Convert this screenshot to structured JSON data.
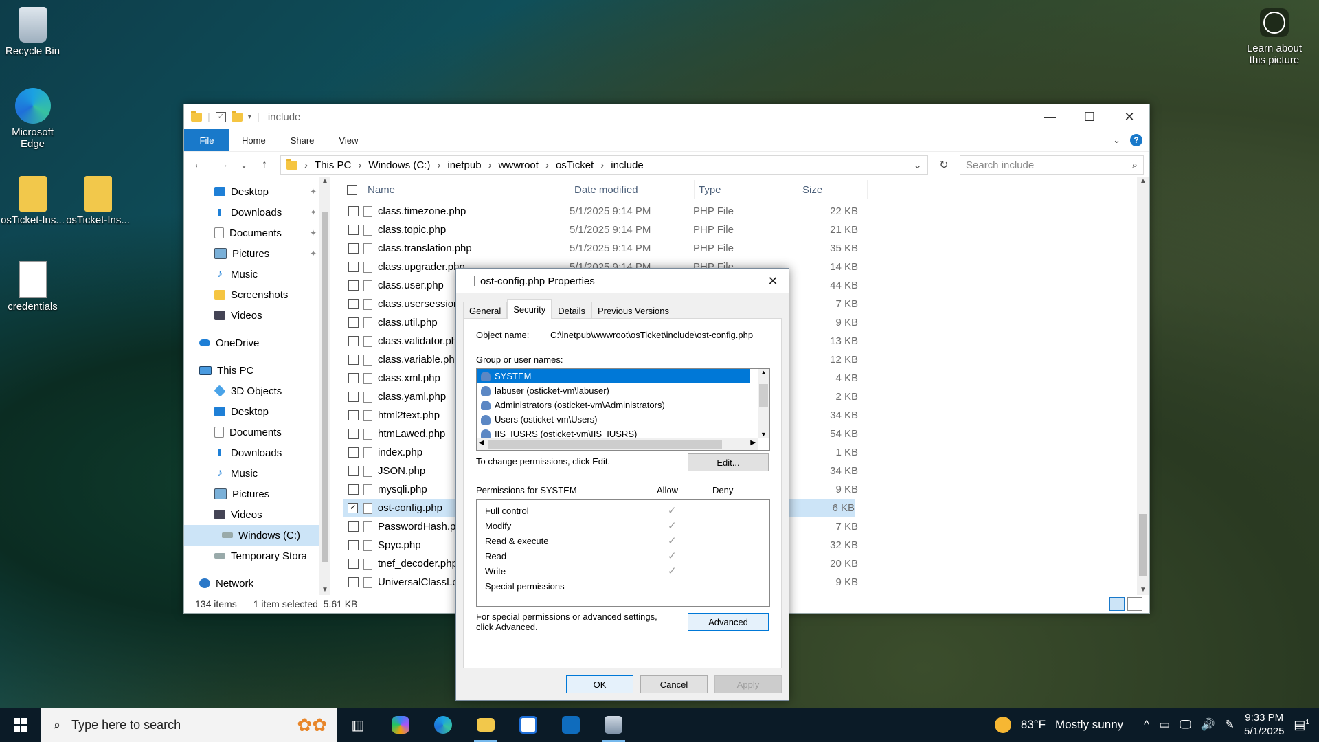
{
  "desktop": {
    "icons": [
      {
        "label": "Recycle Bin"
      },
      {
        "label": "Microsoft Edge"
      },
      {
        "label": "osTicket-Ins..."
      },
      {
        "label": "osTicket-Ins..."
      },
      {
        "label": "credentials"
      }
    ],
    "learn": "Learn about this picture"
  },
  "explorer": {
    "title": "include",
    "ribbon": {
      "file": "File",
      "home": "Home",
      "share": "Share",
      "view": "View"
    },
    "breadcrumb": [
      "This PC",
      "Windows (C:)",
      "inetpub",
      "wwwroot",
      "osTicket",
      "include"
    ],
    "search_placeholder": "Search include",
    "nav": {
      "quick": [
        {
          "label": "Desktop",
          "icon": "desktop-icon"
        },
        {
          "label": "Downloads",
          "icon": "downloads-icon"
        },
        {
          "label": "Documents",
          "icon": "documents-icon"
        },
        {
          "label": "Pictures",
          "icon": "pictures-icon"
        },
        {
          "label": "Music",
          "icon": "music-icon"
        },
        {
          "label": "Screenshots",
          "icon": "folder-icon"
        },
        {
          "label": "Videos",
          "icon": "videos-icon"
        }
      ],
      "onedrive": "OneDrive",
      "thispc": "This PC",
      "pc": [
        {
          "label": "3D Objects"
        },
        {
          "label": "Desktop"
        },
        {
          "label": "Documents"
        },
        {
          "label": "Downloads"
        },
        {
          "label": "Music"
        },
        {
          "label": "Pictures"
        },
        {
          "label": "Videos"
        },
        {
          "label": "Windows (C:)"
        },
        {
          "label": "Temporary Stora"
        }
      ],
      "network": "Network"
    },
    "columns": {
      "name": "Name",
      "date": "Date modified",
      "type": "Type",
      "size": "Size"
    },
    "files": [
      {
        "name": "class.timezone.php",
        "date": "5/1/2025 9:14 PM",
        "type": "PHP File",
        "size": "22 KB"
      },
      {
        "name": "class.topic.php",
        "date": "5/1/2025 9:14 PM",
        "type": "PHP File",
        "size": "21 KB"
      },
      {
        "name": "class.translation.php",
        "date": "5/1/2025 9:14 PM",
        "type": "PHP File",
        "size": "35 KB"
      },
      {
        "name": "class.upgrader.php",
        "date": "5/1/2025 9:14 PM",
        "type": "PHP File",
        "size": "14 KB"
      },
      {
        "name": "class.user.php",
        "date": "",
        "type": "",
        "size": "44 KB"
      },
      {
        "name": "class.usersession.php",
        "date": "",
        "type": "",
        "size": "7 KB"
      },
      {
        "name": "class.util.php",
        "date": "",
        "type": "",
        "size": "9 KB"
      },
      {
        "name": "class.validator.php",
        "date": "",
        "type": "",
        "size": "13 KB"
      },
      {
        "name": "class.variable.php",
        "date": "",
        "type": "",
        "size": "12 KB"
      },
      {
        "name": "class.xml.php",
        "date": "",
        "type": "",
        "size": "4 KB"
      },
      {
        "name": "class.yaml.php",
        "date": "",
        "type": "",
        "size": "2 KB"
      },
      {
        "name": "html2text.php",
        "date": "",
        "type": "",
        "size": "34 KB"
      },
      {
        "name": "htmLawed.php",
        "date": "",
        "type": "",
        "size": "54 KB"
      },
      {
        "name": "index.php",
        "date": "",
        "type": "",
        "size": "1 KB"
      },
      {
        "name": "JSON.php",
        "date": "",
        "type": "",
        "size": "34 KB"
      },
      {
        "name": "mysqli.php",
        "date": "",
        "type": "",
        "size": "9 KB"
      },
      {
        "name": "ost-config.php",
        "date": "",
        "type": "",
        "size": "6 KB",
        "selected": true
      },
      {
        "name": "PasswordHash.php",
        "date": "",
        "type": "",
        "size": "7 KB"
      },
      {
        "name": "Spyc.php",
        "date": "",
        "type": "",
        "size": "32 KB"
      },
      {
        "name": "tnef_decoder.php",
        "date": "",
        "type": "",
        "size": "20 KB"
      },
      {
        "name": "UniversalClassLoader.php",
        "date": "",
        "type": "",
        "size": "9 KB"
      }
    ],
    "status": {
      "count": "134 items",
      "selected": "1 item selected",
      "size": "5.61 KB"
    }
  },
  "props": {
    "title": "ost-config.php Properties",
    "tabs": [
      "General",
      "Security",
      "Details",
      "Previous Versions"
    ],
    "object_label": "Object name:",
    "object_value": "C:\\inetpub\\wwwroot\\osTicket\\include\\ost-config.php",
    "group_label": "Group or user names:",
    "users": [
      "SYSTEM",
      "labuser (osticket-vm\\labuser)",
      "Administrators (osticket-vm\\Administrators)",
      "Users (osticket-vm\\Users)",
      "IIS_IUSRS (osticket-vm\\IIS_IUSRS)"
    ],
    "change_text": "To change permissions, click Edit.",
    "edit": "Edit...",
    "perm_for": "Permissions for SYSTEM",
    "allow": "Allow",
    "deny": "Deny",
    "perms": [
      {
        "name": "Full control",
        "allow": true
      },
      {
        "name": "Modify",
        "allow": true
      },
      {
        "name": "Read & execute",
        "allow": true
      },
      {
        "name": "Read",
        "allow": true
      },
      {
        "name": "Write",
        "allow": true
      },
      {
        "name": "Special permissions",
        "allow": false
      }
    ],
    "special_text_1": "For special permissions or advanced settings,",
    "special_text_2": "click Advanced.",
    "advanced": "Advanced",
    "ok": "OK",
    "cancel": "Cancel",
    "apply": "Apply"
  },
  "taskbar": {
    "search": "Type here to search",
    "weather_temp": "83°F",
    "weather_desc": "Mostly sunny",
    "time": "9:33 PM",
    "date": "5/1/2025",
    "notif": "1"
  }
}
